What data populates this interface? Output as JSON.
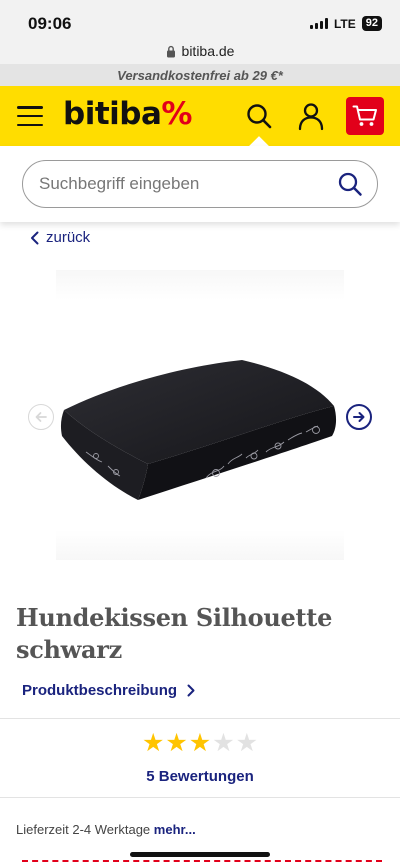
{
  "status_bar": {
    "time": "09:06",
    "network": "LTE",
    "battery": "92"
  },
  "browser": {
    "url": "bitiba.de"
  },
  "promo": {
    "text": "Versandkostenfrei ab 29 €*"
  },
  "header": {
    "logo_text": "bitiba",
    "logo_suffix": "%",
    "brand_colors": {
      "yellow": "#ffdd00",
      "red": "#e2001a",
      "navy": "#1a237e"
    },
    "icons": [
      "menu-icon",
      "search-icon",
      "account-icon",
      "cart-icon"
    ]
  },
  "search": {
    "placeholder": "Suchbegriff eingeben",
    "value": ""
  },
  "navigation": {
    "back_label": "zurück"
  },
  "product": {
    "title_line1": "Hundekissen Silhouette",
    "title_line2": "schwarz",
    "description_link": "Produktbeschreibung",
    "rating": 3,
    "rating_max": 5,
    "reviews_label": "5 Bewertungen",
    "delivery_text": "Lieferzeit 2-4 Werktage",
    "delivery_more": "mehr..."
  }
}
